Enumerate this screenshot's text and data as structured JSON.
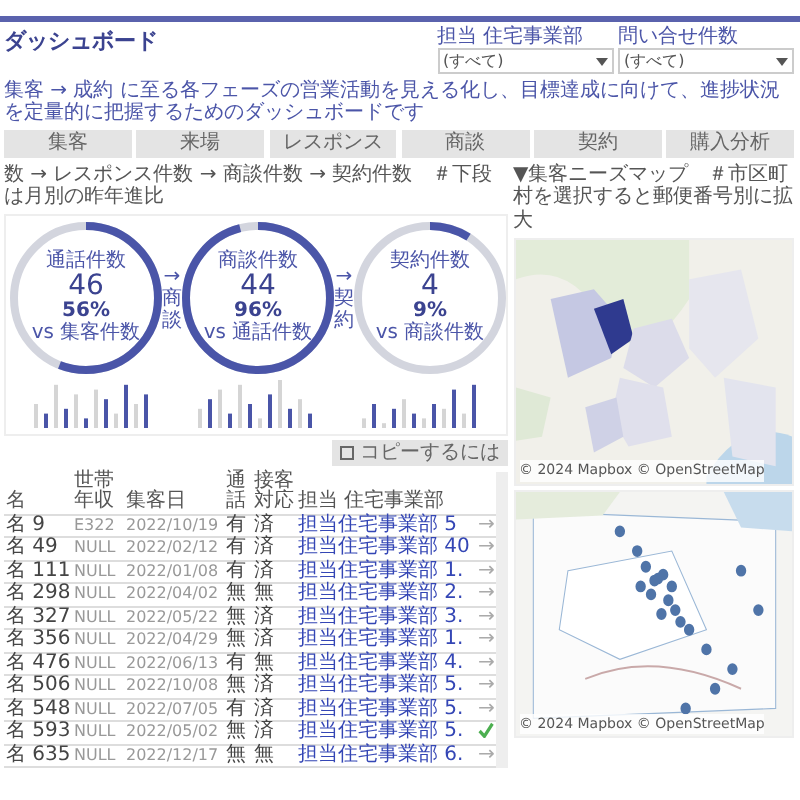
{
  "header": {
    "title": "ダッシュボード",
    "subtitle": "集客 → 成約 に至る各フェーズの営業活動を見える化し、目標達成に向けて、進捗状況を定量的に把握するためのダッシュボードです",
    "filters": [
      {
        "label": "担当 住宅事業部",
        "value": "(すべて)"
      },
      {
        "label": "問い合せ件数",
        "value": "(すべて)"
      }
    ]
  },
  "nav": [
    "集客",
    "来場",
    "レスポンス",
    "商談",
    "契約",
    "購入分析"
  ],
  "funnel": {
    "heading": "数 → レスポンス件数 → 商談件数 → 契約件数　＃下段は月別の昨年進比",
    "steps": [
      {
        "kind": "gauge",
        "label": "通話件数",
        "value": "46",
        "percent": "56%",
        "vs": "vs 集客件数",
        "level": 0.56
      },
      {
        "kind": "connector",
        "arrow": "→",
        "label": "商談"
      },
      {
        "kind": "gauge",
        "label": "商談件数",
        "value": "44",
        "percent": "96%",
        "vs": "vs 通話件数",
        "level": 0.96
      },
      {
        "kind": "connector",
        "arrow": "→",
        "label": "契約"
      },
      {
        "kind": "gauge",
        "label": "契約件数",
        "value": "4",
        "percent": "9%",
        "vs": "vs 商談件数",
        "level": 0.09
      }
    ]
  },
  "copy_button": "コピーするには",
  "table": {
    "columns": [
      "名",
      "世帯年収",
      "集客日",
      "通話",
      "接客対応",
      "担当 住宅事業部"
    ],
    "rows": [
      {
        "cells": [
          "名 9",
          "E322",
          "2022/10/19",
          "有",
          "済",
          "担当住宅事業部 5"
        ],
        "action": "→",
        "done": false
      },
      {
        "cells": [
          "名 49",
          "NULL",
          "2022/02/12",
          "有",
          "済",
          "担当住宅事業部 40"
        ],
        "action": "→",
        "done": false
      },
      {
        "cells": [
          "名 111",
          "NULL",
          "2022/01/08",
          "有",
          "済",
          "担当住宅事業部 1."
        ],
        "action": "→",
        "done": false
      },
      {
        "cells": [
          "名 298",
          "NULL",
          "2022/04/02",
          "無",
          "無",
          "担当住宅事業部 2."
        ],
        "action": "→",
        "done": false
      },
      {
        "cells": [
          "名 327",
          "NULL",
          "2022/05/22",
          "無",
          "済",
          "担当住宅事業部 3."
        ],
        "action": "→",
        "done": false
      },
      {
        "cells": [
          "名 356",
          "NULL",
          "2022/04/29",
          "無",
          "済",
          "担当住宅事業部 1."
        ],
        "action": "→",
        "done": false
      },
      {
        "cells": [
          "名 476",
          "NULL",
          "2022/06/13",
          "有",
          "無",
          "担当住宅事業部 4."
        ],
        "action": "→",
        "done": false
      },
      {
        "cells": [
          "名 506",
          "NULL",
          "2022/10/08",
          "無",
          "済",
          "担当住宅事業部 5."
        ],
        "action": "→",
        "done": false
      },
      {
        "cells": [
          "名 548",
          "NULL",
          "2022/07/05",
          "有",
          "済",
          "担当住宅事業部 5."
        ],
        "action": "→",
        "done": false
      },
      {
        "cells": [
          "名 593",
          "NULL",
          "2022/05/02",
          "無",
          "済",
          "担当住宅事業部 5."
        ],
        "done": true
      },
      {
        "cells": [
          "名 635",
          "NULL",
          "2022/12/17",
          "無",
          "無",
          "担当住宅事業部 6."
        ],
        "action": "→",
        "done": false
      }
    ]
  },
  "map": {
    "heading": "▼集客ニーズマップ　＃市区町村を選択すると郵便番号別に拡大",
    "attributions": [
      "© 2024 Mapbox © OpenStreetMap",
      "© 2024 Mapbox © OpenStreetMap"
    ]
  }
}
